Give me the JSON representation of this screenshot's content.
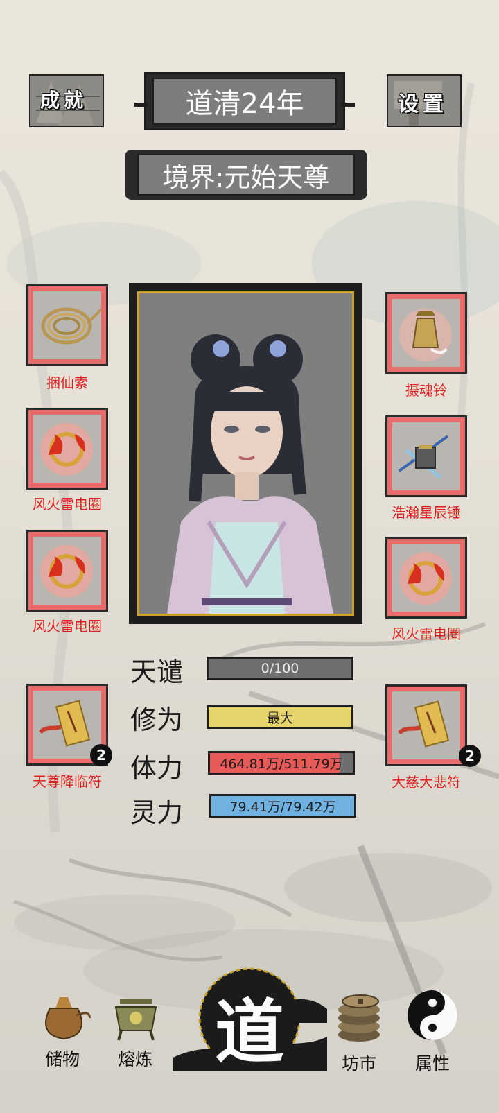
{
  "header": {
    "achievement_label": "成就",
    "settings_label": "设置",
    "year": "道清24年",
    "realm": "境界:元始天尊"
  },
  "left_slots": [
    {
      "label": "捆仙索",
      "icon": "rope-icon"
    },
    {
      "label": "风火雷电圈",
      "icon": "fire-ring-icon"
    },
    {
      "label": "风火雷电圈",
      "icon": "fire-ring-icon"
    },
    {
      "label": "天尊降临符",
      "icon": "talisman-icon",
      "count": "2"
    }
  ],
  "right_slots": [
    {
      "label": "摄魂铃",
      "icon": "bell-icon"
    },
    {
      "label": "浩瀚星辰锤",
      "icon": "hammer-icon"
    },
    {
      "label": "风火雷电圈",
      "icon": "fire-ring-icon"
    },
    {
      "label": "大慈大悲符",
      "icon": "talisman-icon",
      "count": "2"
    }
  ],
  "stats": [
    {
      "name": "天谴",
      "value": "0/100",
      "fill": 0.0,
      "color": "#6e6e6e"
    },
    {
      "name": "修为",
      "value": "最大",
      "fill": 1.0,
      "color": "#e6d36a"
    },
    {
      "name": "体力",
      "value": "464.81万/511.79万",
      "fill": 0.908,
      "color": "#e65a58"
    },
    {
      "name": "灵力",
      "value": "79.41万/79.42万",
      "fill": 0.999,
      "color": "#6fb1e0"
    }
  ],
  "nav": {
    "storage": "储物",
    "smelt": "熔炼",
    "center": "道",
    "market": "坊市",
    "attributes": "属性"
  },
  "colors": {
    "slot_border": "#e86c6c",
    "label_red": "#e01e1e",
    "frame_gold": "#c9a227"
  }
}
